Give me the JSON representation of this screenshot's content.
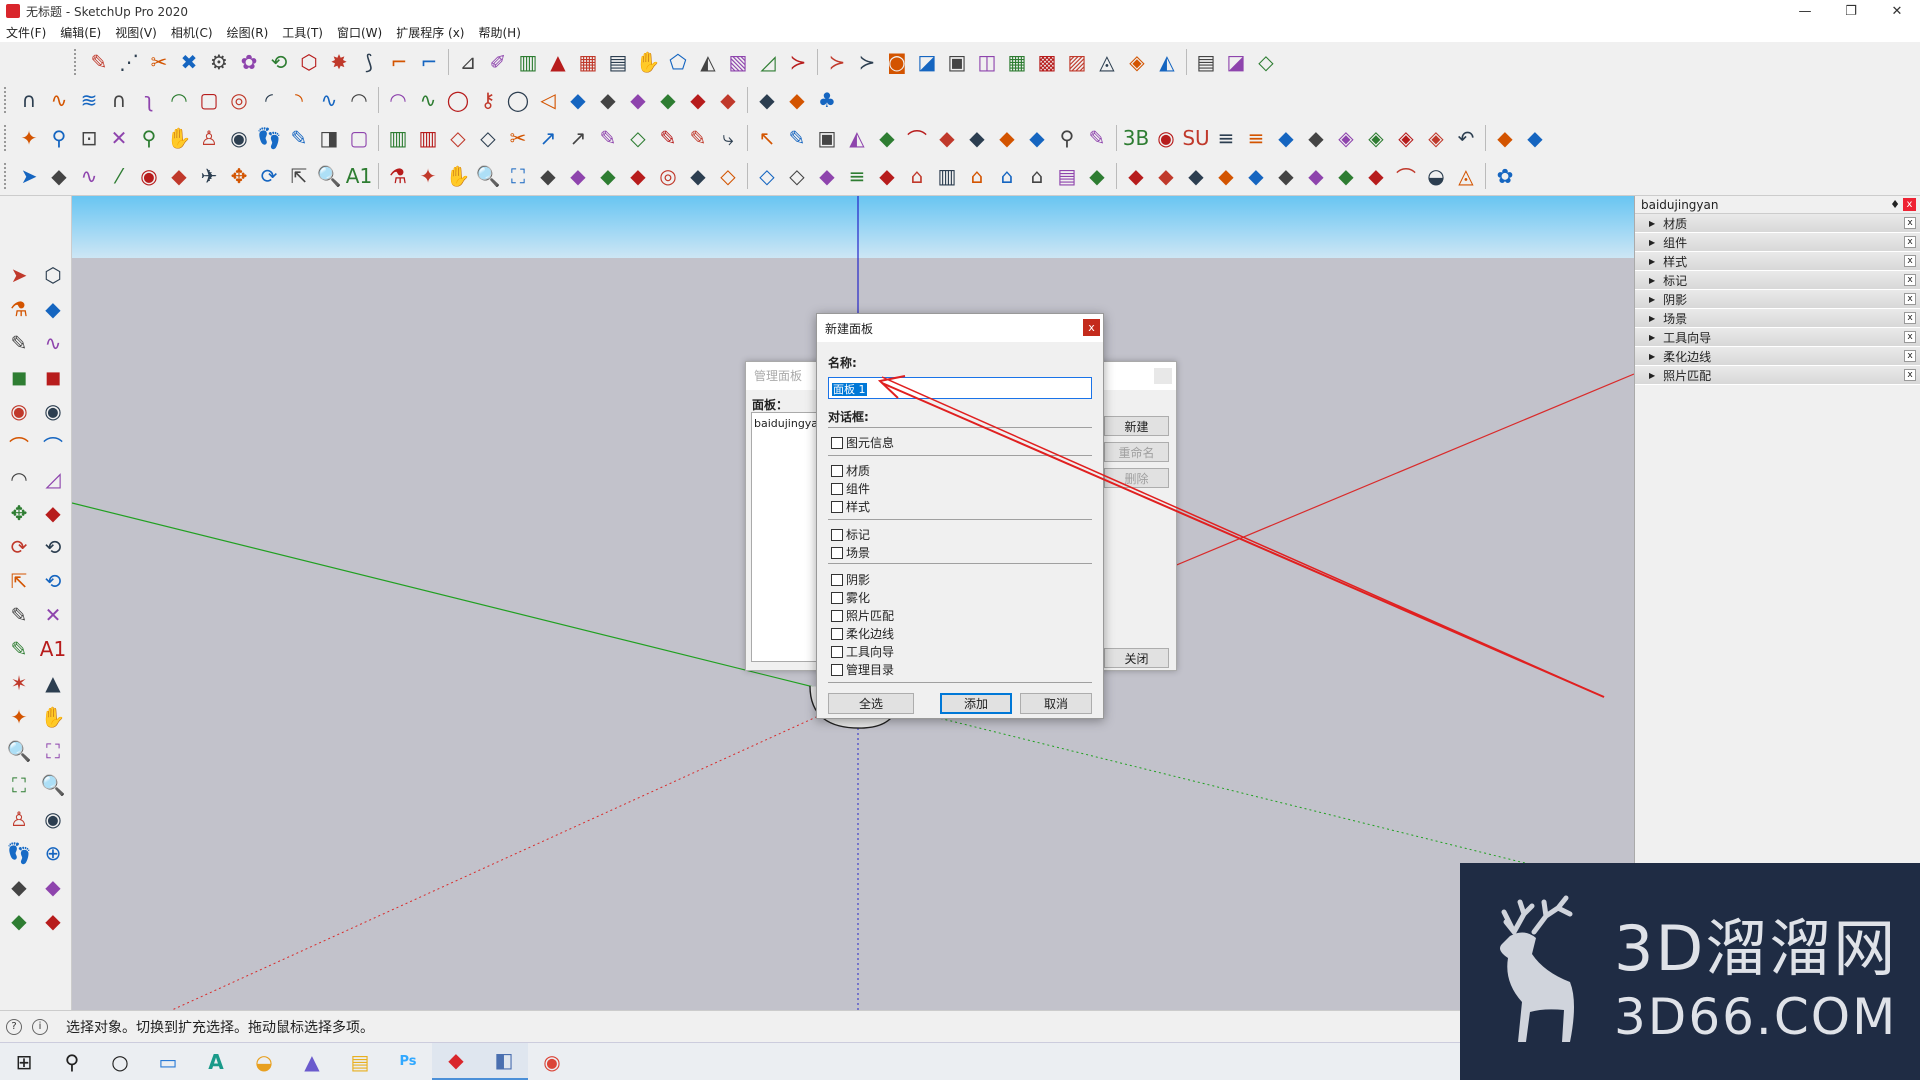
{
  "window": {
    "title": "无标题 - SketchUp Pro 2020",
    "controls": [
      "—",
      "❐",
      "✕"
    ]
  },
  "menu": [
    "文件(F)",
    "编辑(E)",
    "视图(V)",
    "相机(C)",
    "绘图(R)",
    "工具(T)",
    "窗口(W)",
    "扩展程序 (x)",
    "帮助(H)"
  ],
  "toolbar_icons": {
    "row1": [
      "✎",
      "⋰",
      "✂",
      "✖",
      "⚙",
      "✿",
      "⟲",
      "⬡",
      "✸",
      "⟆",
      "⌐",
      "⌐",
      "⊿",
      "✐",
      "▥",
      "▲",
      "▦",
      "▤",
      "✋",
      "⬠",
      "◭",
      "▧",
      "◿",
      "≻",
      "≻",
      "≻",
      "◙",
      "◪",
      "▣",
      "◫",
      "▦",
      "▩",
      "▨",
      "◬",
      "◈",
      "◭",
      "▤",
      "◪",
      "◇"
    ],
    "row2": [
      "∩",
      "∿",
      "≋",
      "∩",
      "ʅ",
      "◠",
      "▢",
      "◎",
      "◜",
      "◝",
      "∿",
      "◠",
      "◠",
      "∿",
      "◯",
      "⚷",
      "◯",
      "◁",
      "◆",
      "◆",
      "◆",
      "◆",
      "◆",
      "◆",
      "◆",
      "◆",
      "♣"
    ],
    "row3": [
      "✦",
      "⚲",
      "⊡",
      "✕",
      "⚲",
      "✋",
      "♙",
      "◉",
      "👣",
      "✎",
      "◨",
      "▢",
      "▥",
      "▥",
      "◇",
      "◇",
      "✂",
      "↗",
      "↗",
      "✎",
      "◇",
      "✎",
      "✎",
      "⤷",
      "↖",
      "✎",
      "▣",
      "◭",
      "◆",
      "⌒",
      "◆",
      "◆",
      "◆",
      "◆",
      "⚲",
      "✎",
      "3B",
      "◉",
      "SU",
      "≡",
      "≡",
      "◆",
      "◆",
      "◈",
      "◈",
      "◈",
      "◈",
      "↶",
      "◆",
      "◆"
    ],
    "row4": [
      "➤",
      "◆",
      "∿",
      "⁄",
      "◉",
      "◆",
      "✈",
      "✥",
      "⟳",
      "⇱",
      "🔍",
      "A1",
      "⚗",
      "✦",
      "✋",
      "🔍",
      "⛶",
      "◆",
      "◆",
      "◆",
      "◆",
      "◎",
      "◆",
      "◇",
      "◇",
      "◇",
      "◆",
      "≡",
      "◆",
      "⌂",
      "▥",
      "⌂",
      "⌂",
      "⌂",
      "▤",
      "◆",
      "◆",
      "◆",
      "◆",
      "◆",
      "◆",
      "◆",
      "◆",
      "◆",
      "◆",
      "⌒",
      "◒",
      "◬",
      "✿"
    ]
  },
  "left_toolbar_icons": [
    "➤",
    "⬡",
    "⚗",
    "◆",
    "✎",
    "∿",
    "◼",
    "◼",
    "◉",
    "◉",
    "⌒",
    "⌒",
    "◠",
    "◿",
    "✥",
    "◆",
    "⟳",
    "⟲",
    "⇱",
    "⟲",
    "✎",
    "✕",
    "✎",
    "A1",
    "✶",
    "▲",
    "✦",
    "✋",
    "🔍",
    "⛶",
    "⛶",
    "🔍",
    "♙",
    "◉",
    "👣",
    "⊕",
    "◆",
    "◆",
    "◆",
    "◆"
  ],
  "tray": {
    "title": "baidujingyan",
    "pin": "♦",
    "close": "x",
    "panels": [
      "材质",
      "组件",
      "样式",
      "标记",
      "阴影",
      "场景",
      "工具向导",
      "柔化边线",
      "照片匹配"
    ]
  },
  "manage_dialog": {
    "title": "管理面板",
    "list_label": "面板：",
    "list_items": [
      "baidujingyan"
    ],
    "buttons": {
      "new": "新建",
      "rename": "重命名",
      "delete": "删除",
      "close": "关闭"
    }
  },
  "new_panel_dialog": {
    "title": "新建面板",
    "close": "x",
    "name_label": "名称:",
    "name_value": "面板 1",
    "dialogs_label": "对话框:",
    "groups": [
      [
        "图元信息"
      ],
      [
        "材质",
        "组件",
        "样式"
      ],
      [
        "标记",
        "场景"
      ],
      [
        "阴影",
        "雾化",
        "照片匹配",
        "柔化边线",
        "工具向导",
        "管理目录"
      ]
    ],
    "buttons": {
      "select_all": "全选",
      "add": "添加",
      "cancel": "取消"
    }
  },
  "status": {
    "text": "选择对象。切换到扩充选择。拖动鼠标选择多项。",
    "icons": [
      "?",
      "i"
    ]
  },
  "taskbar": [
    "⊞",
    "⚲",
    "○",
    "▭",
    "A",
    "◒",
    "▲",
    "▤",
    "Ps",
    "◆",
    "◧",
    "◉"
  ],
  "watermark": {
    "line1": "3D溜溜网",
    "line2": "3D66.COM"
  },
  "colors": {
    "axis_red": "#d92b2b",
    "axis_green": "#20a020",
    "axis_blue": "#2626c8",
    "annotation_arrow": "#e02020",
    "sky_top": "#68c5f2",
    "ground": "#c2c2cb",
    "watermark_bg": "#1f2c44"
  }
}
